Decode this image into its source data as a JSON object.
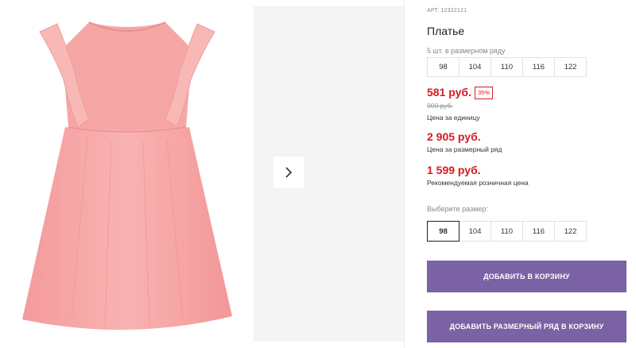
{
  "product": {
    "article": "АРТ. 12322121",
    "title": "Платье",
    "series_note": "5 шт. в размерном ряду",
    "series_sizes": [
      "98",
      "104",
      "110",
      "116",
      "122"
    ]
  },
  "pricing": {
    "unit_price": "581 руб.",
    "discount_badge": "35%",
    "old_price": "900 руб.",
    "unit_caption": "Цена за единицу",
    "series_price": "2 905 руб.",
    "series_caption": "Цена за размерный ряд",
    "retail_price": "1 599 руб.",
    "retail_caption": "Рекомендуемая розничная цена"
  },
  "size_picker": {
    "label": "Выберите размер:",
    "sizes": [
      "98",
      "104",
      "110",
      "116",
      "122"
    ],
    "selected": "98"
  },
  "actions": {
    "add_to_cart": "ДОБАВИТЬ В КОРЗИНУ",
    "add_series_to_cart": "ДОБАВИТЬ РАЗМЕРНЫЙ РЯД В КОРЗИНУ"
  },
  "colors": {
    "accent_price": "#d71920",
    "button_bg": "#7a62a4",
    "dress": "#f7a9a8"
  },
  "icons": {
    "gallery_next": "chevron-right-icon"
  }
}
